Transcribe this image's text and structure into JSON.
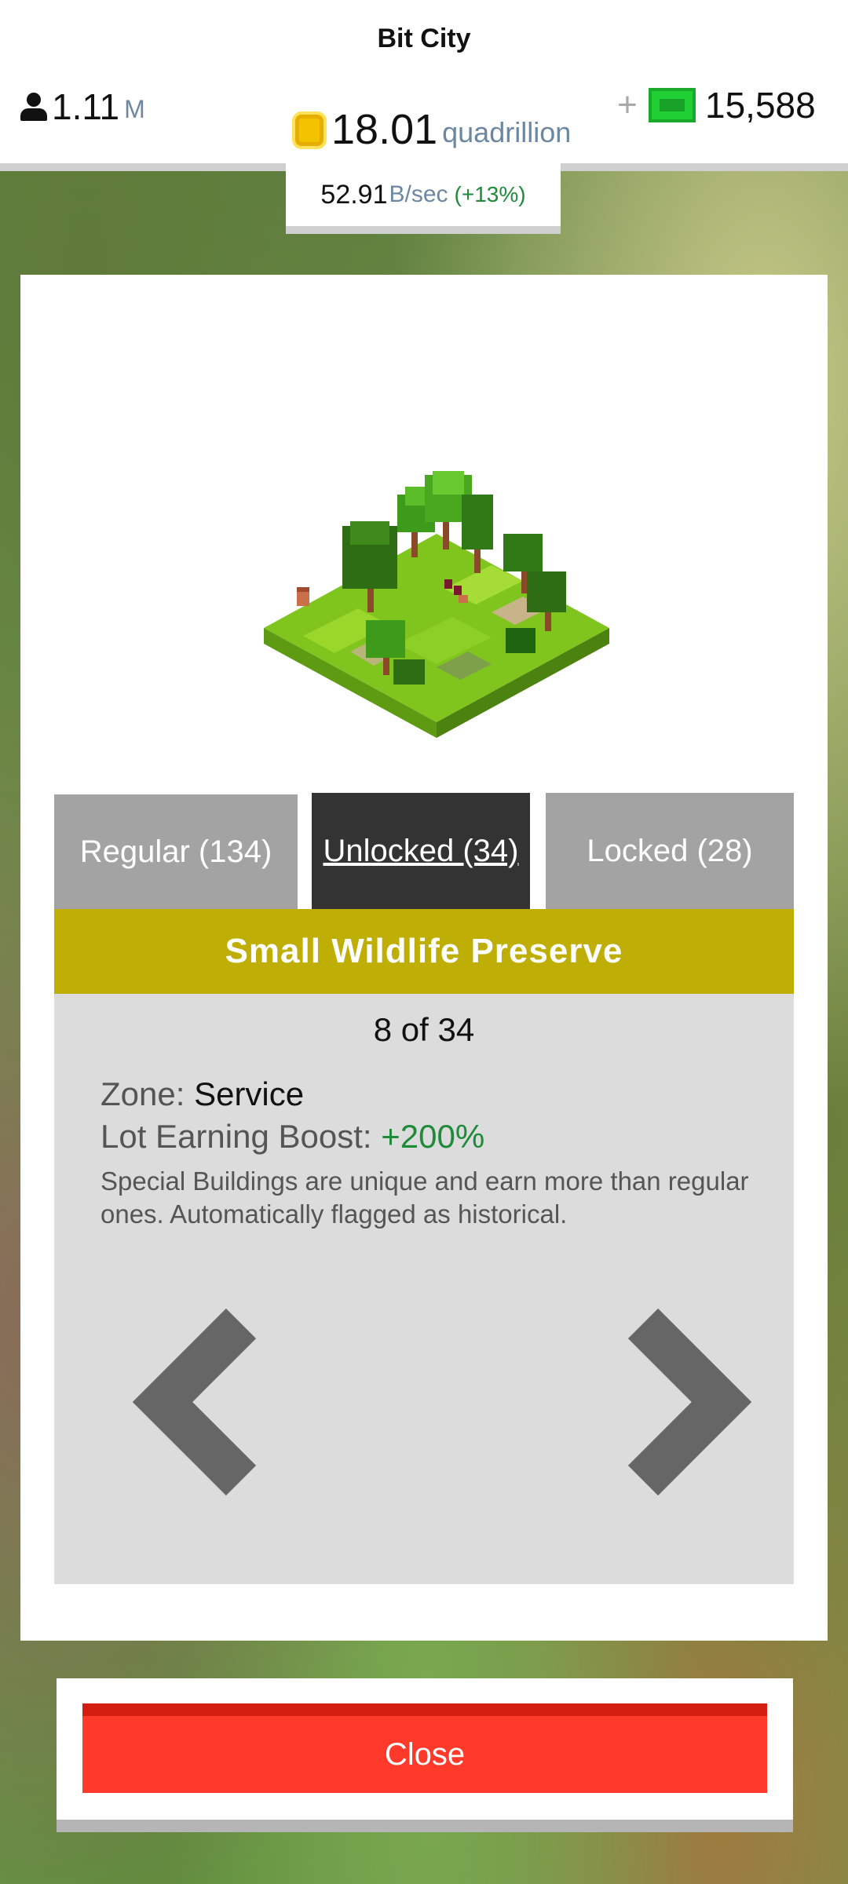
{
  "header": {
    "title": "Bit City",
    "population": {
      "value": "1.11",
      "unit": "M"
    },
    "coins": {
      "value": "18.01",
      "unit": "quadrillion"
    },
    "bux": {
      "value": "15,588"
    },
    "rate": {
      "value": "52.91",
      "unit": "B/sec",
      "bonus": "(+13%)"
    }
  },
  "tabs": [
    {
      "label": "Regular (134)"
    },
    {
      "label": "Unlocked (34)"
    },
    {
      "label": "Locked (28)"
    }
  ],
  "building": {
    "name": "Small Wildlife Preserve",
    "counter": "8 of 34",
    "zone_label": "Zone: ",
    "zone_value": "Service",
    "boost_label": "Lot Earning Boost: ",
    "boost_value": "+200%",
    "description": "Special Buildings are unique and earn more than regular ones. Automatically flagged as historical."
  },
  "actions": {
    "close_label": "Close"
  },
  "colors": {
    "banner": "#bfae06",
    "active_tab": "#333333",
    "inactive_tab": "#a3a3a3",
    "close_button": "#ff3a2a",
    "positive": "#1f8a3a"
  }
}
